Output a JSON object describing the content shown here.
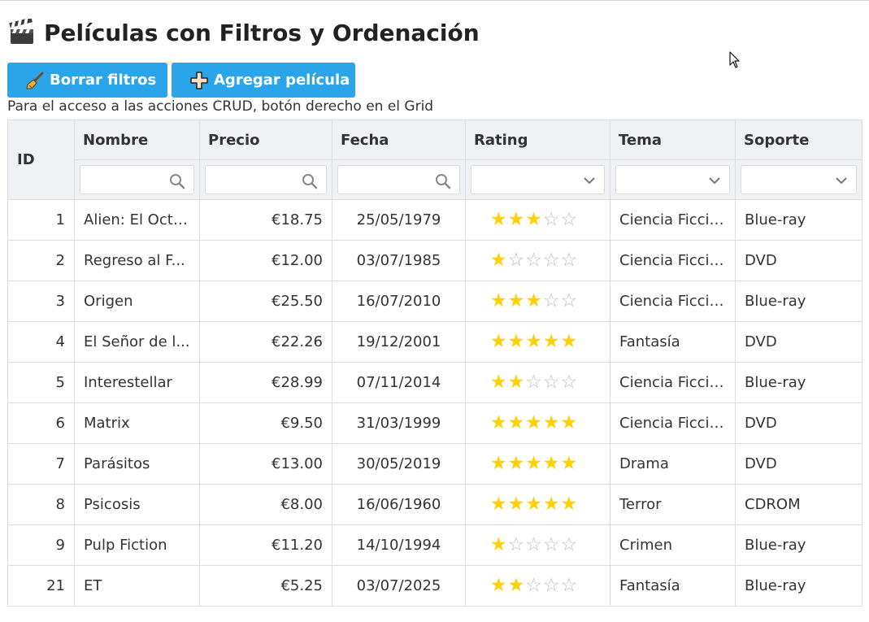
{
  "page": {
    "title": "Películas con Filtros y Ordenación",
    "title_icon": "clapperboard-icon"
  },
  "toolbar": {
    "clear_filters_label": "Borrar filtros",
    "clear_filters_icon": "broom-icon",
    "add_movie_label": "Agregar película",
    "add_movie_icon": "plus-icon"
  },
  "hint": "Para el acceso a las acciones CRUD, botón derecho en el Grid",
  "colors": {
    "accent": "#2aa5ea",
    "star": "#ffd100",
    "header_bg": "#f0f1f5"
  },
  "grid": {
    "columns": [
      "ID",
      "Nombre",
      "Precio",
      "Fecha",
      "Rating",
      "Tema",
      "Soporte"
    ],
    "filters": {
      "nombre": {
        "type": "text",
        "value": "",
        "icon": "search-icon"
      },
      "precio": {
        "type": "text",
        "value": "",
        "icon": "search-icon"
      },
      "fecha": {
        "type": "text",
        "value": "",
        "icon": "search-icon"
      },
      "rating": {
        "type": "select",
        "value": "",
        "icon": "chevron-down-icon"
      },
      "tema": {
        "type": "select",
        "value": "",
        "icon": "chevron-down-icon"
      },
      "soporte": {
        "type": "select",
        "value": "",
        "icon": "chevron-down-icon"
      }
    },
    "rating_max": 5,
    "rows": [
      {
        "id": "1",
        "nombre": "Alien: El Octa...",
        "precio": "€18.75",
        "fecha": "25/05/1979",
        "rating": 3,
        "tema": "Ciencia Ficción",
        "soporte": "Blue-ray"
      },
      {
        "id": "2",
        "nombre": "Regreso al F...",
        "precio": "€12.00",
        "fecha": "03/07/1985",
        "rating": 1,
        "tema": "Ciencia Ficción",
        "soporte": "DVD"
      },
      {
        "id": "3",
        "nombre": "Origen",
        "precio": "€25.50",
        "fecha": "16/07/2010",
        "rating": 3,
        "tema": "Ciencia Ficción",
        "soporte": "Blue-ray"
      },
      {
        "id": "4",
        "nombre": "El Señor de l...",
        "precio": "€22.26",
        "fecha": "19/12/2001",
        "rating": 5,
        "tema": "Fantasía",
        "soporte": "DVD"
      },
      {
        "id": "5",
        "nombre": "Interestellar",
        "precio": "€28.99",
        "fecha": "07/11/2014",
        "rating": 2,
        "tema": "Ciencia Ficción",
        "soporte": "Blue-ray"
      },
      {
        "id": "6",
        "nombre": "Matrix",
        "precio": "€9.50",
        "fecha": "31/03/1999",
        "rating": 5,
        "tema": "Ciencia Ficción",
        "soporte": "DVD"
      },
      {
        "id": "7",
        "nombre": "Parásitos",
        "precio": "€13.00",
        "fecha": "30/05/2019",
        "rating": 5,
        "tema": "Drama",
        "soporte": "DVD"
      },
      {
        "id": "8",
        "nombre": "Psicosis",
        "precio": "€8.00",
        "fecha": "16/06/1960",
        "rating": 5,
        "tema": "Terror",
        "soporte": "CDROM"
      },
      {
        "id": "9",
        "nombre": "Pulp Fiction",
        "precio": "€11.20",
        "fecha": "14/10/1994",
        "rating": 1,
        "tema": "Crimen",
        "soporte": "Blue-ray"
      },
      {
        "id": "21",
        "nombre": "ET",
        "precio": "€5.25",
        "fecha": "03/07/2025",
        "rating": 2,
        "tema": "Fantasía",
        "soporte": "Blue-ray"
      }
    ]
  }
}
